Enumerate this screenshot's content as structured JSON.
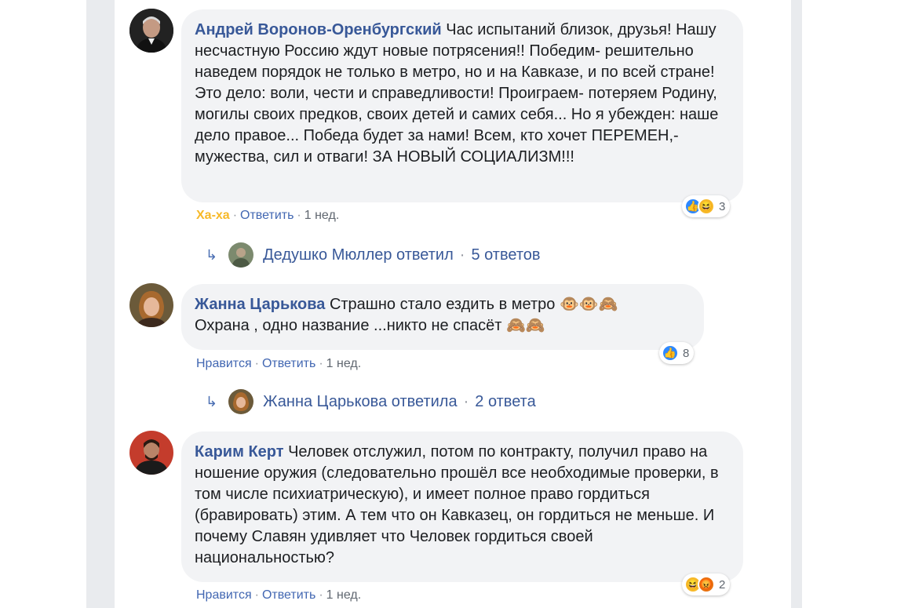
{
  "comments": [
    {
      "author": "Андрей Воронов-Оренбургский",
      "text": "Час испытаний близок, друзья! Нашу несчастную Россию ждут новые потрясения!! Победим- решительно наведем порядок не только в метро, но и на Кавказе, и по всей стране! Это дело: воли, чести и справедливости! Проиграем- потеряем Родину, могилы своих предков, своих детей и самих себя... Но я убежден: наше дело правое... Победа будет за нами! Всем, кто хочет ПЕРЕМЕН,- мужества, сил и отваги! ЗА НОВЫЙ СОЦИАЛИЗМ!!!",
      "reaction_label": "Ха-ха",
      "reply_label": "Ответить",
      "time": "1 нед.",
      "reaction_count": "3",
      "reactions": [
        "like",
        "haha"
      ],
      "replies": {
        "name": "Дедушко Мюллер ответил",
        "count": "5 ответов"
      }
    },
    {
      "author": "Жанна Царькова",
      "text_line1": "Страшно стало ездить в метро 🐵🐵🙈",
      "text_line2": "Охрана , одно название ...никто не спасёт 🙈🙈",
      "reaction_label": "Нравится",
      "reply_label": "Ответить",
      "time": "1 нед.",
      "reaction_count": "8",
      "reactions": [
        "like"
      ],
      "replies": {
        "name": "Жанна Царькова ответила",
        "count": "2 ответа"
      }
    },
    {
      "author": "Карим Керт",
      "text": "Человек отслужил, потом по контракту, получил право на ношение оружия (следовательно прошёл все необходимые проверки, в том числе психиатрическую), и имеет полное право гордиться (бравировать) этим. А тем что он Кавказец, он гордиться не меньше. И почему Славян удивляет что Человек гордиться своей национальностью?",
      "reaction_label": "Нравится",
      "reply_label": "Ответить",
      "time": "1 нед.",
      "reaction_count": "2",
      "reactions": [
        "haha",
        "angry"
      ]
    }
  ],
  "separator": "·",
  "reply_arrow": "↳",
  "colors": {
    "author": "#385898",
    "link": "#4267b2",
    "haha": "#f7b928",
    "bubble": "#f2f3f5"
  }
}
